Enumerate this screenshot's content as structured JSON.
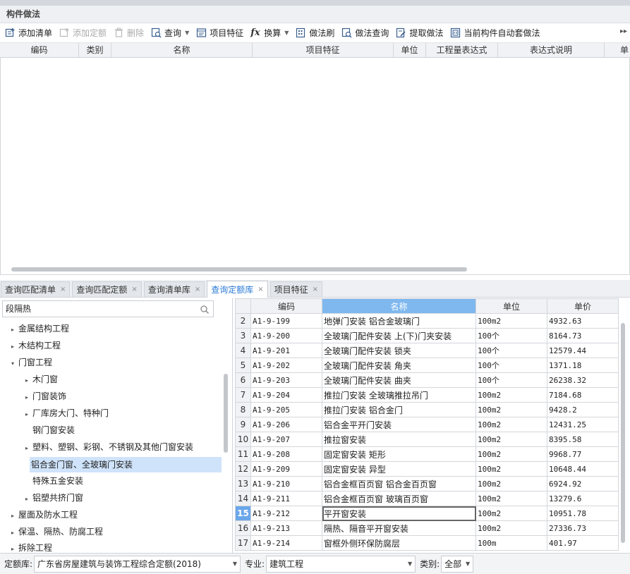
{
  "panel": {
    "title": "构件做法"
  },
  "toolbar": {
    "add_list": "添加清单",
    "add_quota": "添加定额",
    "delete": "删除",
    "query": "查询",
    "project_feature": "项目特征",
    "convert": "换算",
    "method_brush": "做法刷",
    "method_query": "做法查询",
    "extract_method": "提取做法",
    "auto_apply": "当前构件自动套做法"
  },
  "upper_grid": {
    "columns": [
      "编码",
      "类别",
      "名称",
      "项目特征",
      "单位",
      "工程量表达式",
      "表达式说明",
      "单"
    ]
  },
  "tabs": [
    {
      "label": "查询匹配清单"
    },
    {
      "label": "查询匹配定额"
    },
    {
      "label": "查询清单库"
    },
    {
      "label": "查询定额库"
    },
    {
      "label": "项目特征"
    }
  ],
  "search": {
    "value": "段隔热"
  },
  "tree": [
    {
      "label": "金属结构工程",
      "arrow": "▸"
    },
    {
      "label": "木结构工程",
      "arrow": "▸"
    },
    {
      "label": "门窗工程",
      "arrow": "▾"
    },
    {
      "label": "木门窗",
      "arrow": "▸"
    },
    {
      "label": "门窗装饰",
      "arrow": "▸"
    },
    {
      "label": "厂库房大门、特种门",
      "arrow": "▸"
    },
    {
      "label": "钢门窗安装",
      "arrow": ""
    },
    {
      "label": "塑料、塑钢、彩钢、不锈钢及其他门窗安装",
      "arrow": "▸"
    },
    {
      "label": "铝合金门窗、全玻璃门安装",
      "arrow": ""
    },
    {
      "label": "特殊五金安装",
      "arrow": ""
    },
    {
      "label": "铝塑共挤门窗",
      "arrow": "▸"
    },
    {
      "label": "屋面及防水工程",
      "arrow": "▸"
    },
    {
      "label": "保温、隔热、防腐工程",
      "arrow": "▸"
    },
    {
      "label": "拆除工程",
      "arrow": "▸"
    }
  ],
  "quota_table": {
    "columns": [
      "编码",
      "名称",
      "单位",
      "单价"
    ],
    "rows": [
      {
        "n": "2",
        "code": "A1-9-199",
        "name": "地弹门安装 铝合金玻璃门",
        "unit": "100m2",
        "price": "4932.63"
      },
      {
        "n": "3",
        "code": "A1-9-200",
        "name": "全玻璃门配件安装 上(下)门夹安装",
        "unit": "100个",
        "price": "8164.73"
      },
      {
        "n": "4",
        "code": "A1-9-201",
        "name": "全玻璃门配件安装 锁夹",
        "unit": "100个",
        "price": "12579.44"
      },
      {
        "n": "5",
        "code": "A1-9-202",
        "name": "全玻璃门配件安装 角夹",
        "unit": "100个",
        "price": "1371.18"
      },
      {
        "n": "6",
        "code": "A1-9-203",
        "name": "全玻璃门配件安装 曲夹",
        "unit": "100个",
        "price": "26238.32"
      },
      {
        "n": "7",
        "code": "A1-9-204",
        "name": "推拉门安装 全玻璃推拉吊门",
        "unit": "100m2",
        "price": "7184.68"
      },
      {
        "n": "8",
        "code": "A1-9-205",
        "name": "推拉门安装 铝合金门",
        "unit": "100m2",
        "price": "9428.2"
      },
      {
        "n": "9",
        "code": "A1-9-206",
        "name": "铝合金平开门安装",
        "unit": "100m2",
        "price": "12431.25"
      },
      {
        "n": "10",
        "code": "A1-9-207",
        "name": "推拉窗安装",
        "unit": "100m2",
        "price": "8395.58"
      },
      {
        "n": "11",
        "code": "A1-9-208",
        "name": "固定窗安装 矩形",
        "unit": "100m2",
        "price": "9968.77"
      },
      {
        "n": "12",
        "code": "A1-9-209",
        "name": "固定窗安装 异型",
        "unit": "100m2",
        "price": "10648.44"
      },
      {
        "n": "13",
        "code": "A1-9-210",
        "name": "铝合金框百页窗 铝合金百页窗",
        "unit": "100m2",
        "price": "6924.92"
      },
      {
        "n": "14",
        "code": "A1-9-211",
        "name": "铝合金框百页窗 玻璃百页窗",
        "unit": "100m2",
        "price": "13279.6"
      },
      {
        "n": "15",
        "code": "A1-9-212",
        "name": "平开窗安装",
        "unit": "100m2",
        "price": "10951.78"
      },
      {
        "n": "16",
        "code": "A1-9-213",
        "name": "隔热、隔音平开窗安装",
        "unit": "100m2",
        "price": "27336.73"
      },
      {
        "n": "17",
        "code": "A1-9-214",
        "name": "窗框外侧环保防腐层",
        "unit": "100m",
        "price": "401.97"
      }
    ]
  },
  "bottom": {
    "quota_lib_label": "定额库:",
    "quota_lib_value": "广东省房屋建筑与装饰工程综合定额(2018)",
    "major_label": "专业:",
    "major_value": "建筑工程",
    "category_label": "类别:",
    "category_value": "全部"
  }
}
